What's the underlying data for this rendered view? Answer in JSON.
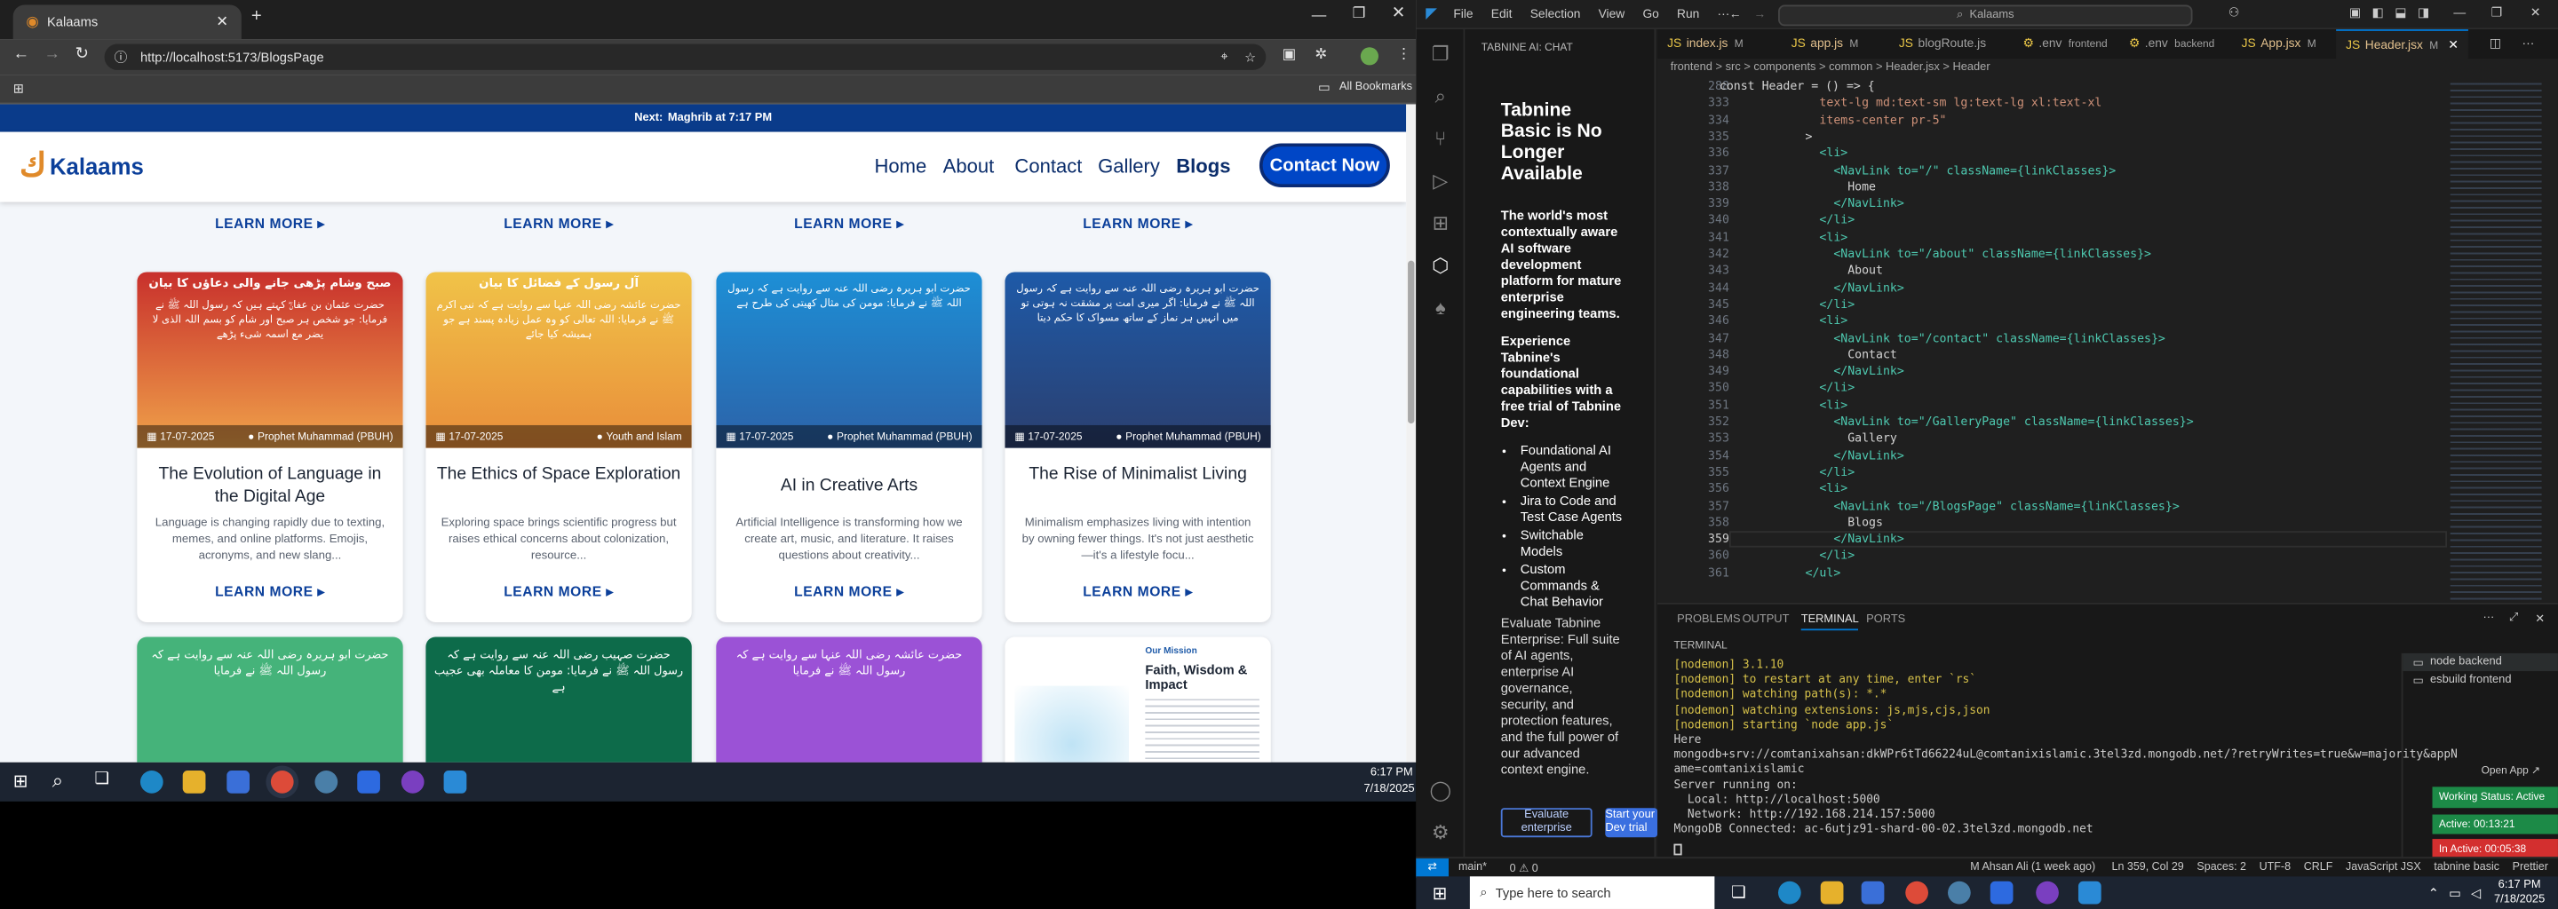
{
  "browser": {
    "tab_title": "Kalaams",
    "url": "http://localhost:5173/BlogsPage",
    "bookmarks": "All Bookmarks"
  },
  "site": {
    "prayer_prefix": "Next:",
    "prayer_text": "Maghrib at 7:17 PM",
    "logo": "Kalaams",
    "nav": [
      "Home",
      "About",
      "Contact",
      "Gallery",
      "Blogs"
    ],
    "contact_button": "Contact Now",
    "learn_more": "LEARN MORE ▸",
    "cards": [
      {
        "title": "The Evolution of Language in the Digital Age",
        "desc": "Language is changing rapidly due to texting, memes, and online platforms. Emojis, acronyms, and new slang...",
        "date": "17-07-2025",
        "tag": "Prophet Muhammad (PBUH)",
        "heading": "صبح وشام پڑھی جانے والی دعاؤں کا بیان",
        "urdu": "حضرت عثمان بن عفانؓ کہتے ہیں کہ رسول اللہ ﷺ نے فرمایا: جو شخص ہر صبح اور شام کو بسم اللہ الذی لا یضر مع اسمہ شیء پڑھے",
        "color1": "#c8302c",
        "color2": "#f0a34a"
      },
      {
        "title": "The Ethics of Space Exploration",
        "desc": "Exploring space brings scientific progress but raises ethical concerns about colonization, resource...",
        "date": "17-07-2025",
        "tag": "Youth and Islam",
        "heading": "آل رسول کے فضائل کا بیان",
        "urdu": "حضرت عائشہ رضی اللہ عنہا سے روایت ہے کہ نبی اکرم ﷺ نے فرمایا: اللہ تعالی کو وہ عمل زیادہ پسند ہے جو ہمیشہ کیا جائے",
        "color1": "#f0c348",
        "color2": "#e98d3a"
      },
      {
        "title": "AI in Creative Arts",
        "desc": "Artificial Intelligence is transforming how we create art, music, and literature. It raises questions about creativity...",
        "date": "17-07-2025",
        "tag": "Prophet Muhammad (PBUH)",
        "heading": "",
        "urdu": "حضرت ابو ہریرہ رضی اللہ عنہ سے روایت ہے کہ رسول اللہ ﷺ نے فرمایا: مومن کی مثال کھیتی کی طرح ہے",
        "color1": "#1d8fd6",
        "color2": "#2c62a8"
      },
      {
        "title": "The Rise of Minimalist Living",
        "desc": "Minimalism emphasizes living with intention by owning fewer things. It's not just aesthetic—it's a lifestyle focu...",
        "date": "17-07-2025",
        "tag": "Prophet Muhammad (PBUH)",
        "heading": "",
        "urdu": "حضرت ابو ہریرہ رضی اللہ عنہ سے روایت ہے کہ رسول اللہ ﷺ نے فرمایا: اگر میری امت پر مشقت نہ ہوتی تو میں انہیں ہر نماز کے ساتھ مسواک کا حکم دیتا",
        "color1": "#1e5aa8",
        "color2": "#2b3f6f"
      }
    ],
    "bottom_cards": [
      {
        "urdu": "حضرت ابو ہریرہ رضی اللہ عنہ سے روایت ہے کہ رسول اللہ ﷺ نے فرمایا",
        "color": "#45b37a"
      },
      {
        "urdu": "حضرت صہیب رضی اللہ عنہ سے روایت ہے کہ رسول اللہ ﷺ نے فرمایا: مومن کا معاملہ بھی عجیب ہے",
        "color": "#0d6b4a"
      },
      {
        "urdu": "حضرت عائشہ رضی اللہ عنہا سے روایت ہے کہ رسول اللہ ﷺ نے فرمایا",
        "color": "#9b52d6"
      },
      {
        "mission_label": "Our Mission",
        "mission_title": "Faith, Wisdom & Impact",
        "color": "#ffffff"
      }
    ]
  },
  "taskbar_left": {
    "time": "6:17 PM",
    "date": "7/18/2025"
  },
  "vscode": {
    "menu": [
      "File",
      "Edit",
      "Selection",
      "View",
      "Go",
      "Run",
      "···"
    ],
    "search": "Kalaams",
    "chat_header": "TABNINE AI: CHAT",
    "chat_title": "Tabnine Basic is No Longer Available",
    "chat_p1": "The world's most contextually aware AI software development platform for mature enterprise engineering teams.",
    "chat_p2": "Experience Tabnine's foundational capabilities with a free trial of Tabnine Dev:",
    "chat_list": [
      "Foundational AI Agents and Context Engine",
      "Jira to Code and Test Case Agents",
      "Switchable Models",
      "Custom Commands & Chat Behavior"
    ],
    "chat_p3": "Evaluate Tabnine Enterprise: Full suite of AI agents, enterprise AI governance, security, and protection features, and the full power of our advanced context engine.",
    "btn_eval": "Evaluate enterprise",
    "btn_trial": "Start your Dev trial",
    "tabs": [
      {
        "name": "index.js",
        "mod": "M"
      },
      {
        "name": "app.js",
        "mod": "M"
      },
      {
        "name": "blogRoute.js",
        "mod": ""
      },
      {
        "name": ".env",
        "mod": "frontend"
      },
      {
        "name": ".env",
        "mod": "backend"
      },
      {
        "name": "App.jsx",
        "mod": "M"
      },
      {
        "name": "Header.jsx",
        "mod": "M"
      }
    ],
    "breadcrumb": "frontend > src > components > common > Header.jsx > Header",
    "sticky": "const Header = () => {",
    "line_numbers": [
      "288",
      "333",
      "334",
      "335",
      "336",
      "337",
      "338",
      "339",
      "340",
      "341",
      "342",
      "343",
      "344",
      "345",
      "346",
      "347",
      "348",
      "349",
      "350",
      "351",
      "352",
      "353",
      "354",
      "355",
      "356",
      "357",
      "358",
      "359",
      "360",
      "361"
    ],
    "code": [
      "const Header = () => {",
      "          text-lg md:text-sm lg:text-lg xl:text-xl",
      "          items-center pr-5\"",
      "        >",
      "          <li>",
      "            <NavLink to=\"/\" className={linkClasses}>",
      "              Home",
      "            </NavLink>",
      "          </li>",
      "          <li>",
      "            <NavLink to=\"/about\" className={linkClasses}>",
      "              About",
      "            </NavLink>",
      "          </li>",
      "          <li>",
      "            <NavLink to=\"/contact\" className={linkClasses}>",
      "              Contact",
      "            </NavLink>",
      "          </li>",
      "          <li>",
      "            <NavLink to=\"/GalleryPage\" className={linkClasses}>",
      "              Gallery",
      "            </NavLink>",
      "          </li>",
      "          <li>",
      "            <NavLink to=\"/BlogsPage\" className={linkClasses}>",
      "              Blogs",
      "            </NavLink>",
      "          </li>",
      "        </ul>"
    ],
    "panel_tabs": [
      "PROBLEMS",
      "OUTPUT",
      "TERMINAL",
      "PORTS"
    ],
    "terminal_label": "TERMINAL",
    "terminal": [
      "[nodemon] 3.1.10",
      "[nodemon] to restart at any time, enter `rs`",
      "[nodemon] watching path(s): *.*",
      "[nodemon] watching extensions: js,mjs,cjs,json",
      "[nodemon] starting `node app.js`",
      "Here",
      "mongodb+srv://comtanixahsan:dkWPr6tTd66224uL@comtanixislamic.3tel3zd.mongodb.net/?retryWrites=true&w=majority&appN",
      "ame=comtanixislamic",
      "Server running on:",
      "  Local: http://localhost:5000",
      "  Network: http://192.168.214.157:5000",
      "MongoDB Connected: ac-6utjz91-shard-00-02.3tel3zd.mongodb.net"
    ],
    "terminals": [
      "node backend",
      "esbuild frontend"
    ],
    "open_app": "Open App ↗",
    "working": "Working Status: Active",
    "active": "Active: 00:13:21",
    "inactive": "In Active: 00:05:38",
    "status": {
      "branch": "main*",
      "errors": "0 ⚠ 0",
      "author": "M Ahsan Ali (1 week ago)",
      "pos": "Ln 359, Col 29",
      "spaces": "Spaces: 2",
      "enc": "UTF-8",
      "eol": "CRLF",
      "lang": "JavaScript JSX",
      "tabnine": "tabnine basic",
      "prettier": "Prettier"
    }
  },
  "taskbar": {
    "search": "Type here to search",
    "time": "6:17 PM",
    "date": "7/18/2025"
  }
}
